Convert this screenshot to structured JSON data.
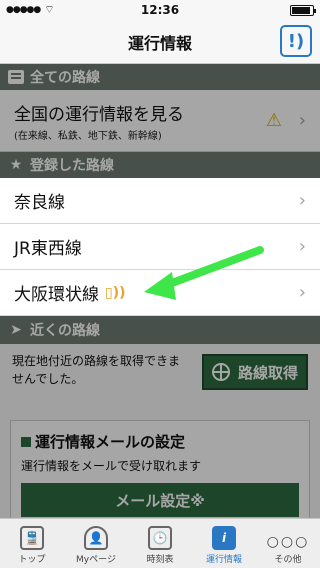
{
  "status": {
    "time": "12:36",
    "signal": "●●●●●"
  },
  "nav": {
    "title": "運行情報",
    "icon": "info-signal-icon"
  },
  "sections": {
    "all": {
      "label": "全ての路線",
      "icon": "list-icon"
    },
    "registered": {
      "label": "登録した路線",
      "icon": "star-icon"
    },
    "nearby": {
      "label": "近くの路線",
      "icon": "location-arrow-icon"
    }
  },
  "all_row": {
    "label": "全国の運行情報を見る",
    "sub": "(在来線、私鉄、地下鉄、新幹線)"
  },
  "registered_lines": [
    {
      "label": "奈良線"
    },
    {
      "label": "JR東西線"
    },
    {
      "label": "大阪環状線"
    }
  ],
  "nearby_text": "現在地付近の路線を取得できませんでした。",
  "get_button": "路線取得",
  "mail": {
    "title": "運行情報メールの設定",
    "desc": "運行情報をメールで受け取れます",
    "button": "メール設定※"
  },
  "tabs": [
    {
      "label": "トップ",
      "icon": "train-icon",
      "glyph": "🚆"
    },
    {
      "label": "Myページ",
      "icon": "person-icon",
      "glyph": "👤"
    },
    {
      "label": "時刻表",
      "icon": "timetable-icon",
      "glyph": "🕒"
    },
    {
      "label": "運行情報",
      "icon": "info-icon",
      "glyph": "i",
      "active": true
    },
    {
      "label": "その他",
      "icon": "more-icon",
      "glyph": "○○○"
    }
  ],
  "colors": {
    "accent": "#2a78c4",
    "green": "#2d6b3f",
    "header": "#6f7c73"
  }
}
